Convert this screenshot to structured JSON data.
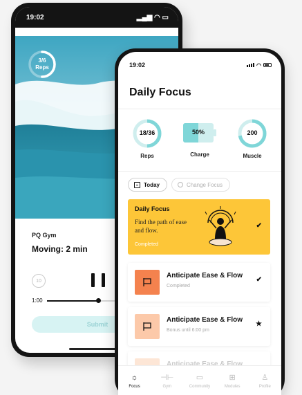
{
  "back_phone": {
    "status_time": "19:02",
    "reps_ring": {
      "value": "3/6",
      "label": "Reps",
      "progress": 0.5
    },
    "location": "PQ Gym",
    "activity": "Moving: 2 min",
    "replay_label": "10",
    "elapsed": "1:00",
    "progress": 0.39,
    "submit_label": "Submit"
  },
  "front_phone": {
    "status_time": "19:02",
    "title": "Daily Focus",
    "stats": {
      "reps": {
        "value": "18/36",
        "label": "Reps",
        "progress": 0.5
      },
      "charge": {
        "value": "50%",
        "label": "Charge",
        "progress": 0.5
      },
      "muscle": {
        "value": "200",
        "label": "Muscle",
        "progress": 0.72
      }
    },
    "chips": {
      "today": "Today",
      "change": "Change Focus"
    },
    "focus_card": {
      "title": "Daily Focus",
      "description": "Find the path of ease and flow.",
      "status": "Completed"
    },
    "tasks": [
      {
        "name": "Anticipate Ease & Flow",
        "sub": "Completed",
        "mark": "✔",
        "color": "#f4824e"
      },
      {
        "name": "Anticipate Ease & Flow",
        "sub": "Bonus until 6:00 pm",
        "mark": "★",
        "color": "#fcc9a9"
      },
      {
        "name": "Anticipate Ease & Flow",
        "sub": "",
        "mark": "",
        "color": "#fde6d6"
      }
    ],
    "tabs": [
      {
        "label": "Focus",
        "active": true
      },
      {
        "label": "Gym",
        "active": false
      },
      {
        "label": "Community",
        "active": false
      },
      {
        "label": "Modules",
        "active": false
      },
      {
        "label": "Profile",
        "active": false
      }
    ]
  },
  "colors": {
    "teal": "#7fd6d8",
    "teal_light": "#cfeeee",
    "yellow": "#fdc638",
    "orange": "#f4824e"
  }
}
